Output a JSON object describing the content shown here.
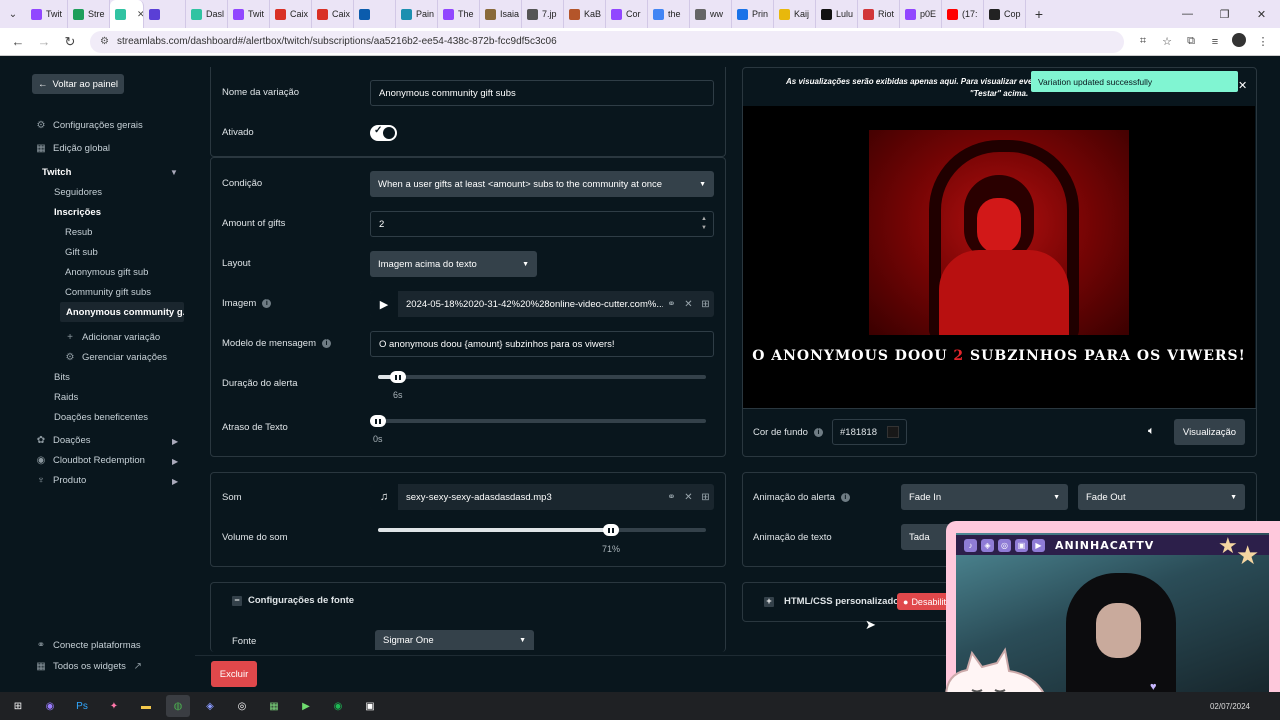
{
  "browser": {
    "tabs": [
      {
        "label": "Twit",
        "color": "#9146ff"
      },
      {
        "label": "Stre",
        "color": "#1e9e5b"
      },
      {
        "label": "",
        "color": "#31c3a2",
        "active": true
      },
      {
        "label": "",
        "color": "#5a3fd6"
      },
      {
        "label": "Dasl",
        "color": "#31c3a2"
      },
      {
        "label": "Twit",
        "color": "#9146ff"
      },
      {
        "label": "Caix",
        "color": "#d93025"
      },
      {
        "label": "Caix",
        "color": "#d93025"
      },
      {
        "label": "",
        "color": "#0b5cad"
      },
      {
        "label": "Pain",
        "color": "#1c8fb0"
      },
      {
        "label": "The",
        "color": "#9146ff"
      },
      {
        "label": "Isaia",
        "color": "#8a6a3a"
      },
      {
        "label": "7.jp",
        "color": "#555555"
      },
      {
        "label": "KaB",
        "color": "#b4552a"
      },
      {
        "label": "Cor",
        "color": "#9146ff"
      },
      {
        "label": "the",
        "color": "#4285f4"
      },
      {
        "label": "ww",
        "color": "#666666"
      },
      {
        "label": "Prin",
        "color": "#1a73e8"
      },
      {
        "label": "Kaij",
        "color": "#e8b80c"
      },
      {
        "label": "Lulu",
        "color": "#111111"
      },
      {
        "label": "Riot",
        "color": "#d13639"
      },
      {
        "label": "p0E",
        "color": "#9146ff"
      },
      {
        "label": "(17:",
        "color": "#ff0000"
      },
      {
        "label": "Cop",
        "color": "#222222"
      }
    ],
    "new_tab": "+",
    "url": "streamlabs.com/dashboard#/alertbox/twitch/subscriptions/aa5216b2-ee54-438c-872b-fcc9df5c3c06"
  },
  "sidebar": {
    "back_label": "Voltar ao painel",
    "items": [
      {
        "label": "Configurações gerais",
        "icon": "gear-icon"
      },
      {
        "label": "Edição global",
        "icon": "grid-icon"
      },
      {
        "label": "Twitch"
      },
      {
        "label": "Seguidores"
      },
      {
        "label": "Inscrições"
      },
      {
        "label": "Resub"
      },
      {
        "label": "Gift sub"
      },
      {
        "label": "Anonymous gift sub"
      },
      {
        "label": "Community gift subs"
      },
      {
        "label": "Anonymous community g..."
      },
      {
        "label": "Adicionar variação",
        "icon": "plus-icon"
      },
      {
        "label": "Gerenciar variações",
        "icon": "gear-icon"
      },
      {
        "label": "Bits"
      },
      {
        "label": "Raids"
      },
      {
        "label": "Doações beneficentes"
      },
      {
        "label": "Doações",
        "icon": "donation-icon"
      },
      {
        "label": "Cloudbot Redemption",
        "icon": "robot-icon"
      },
      {
        "label": "Produto",
        "icon": "shirt-icon"
      }
    ],
    "footer": {
      "connect": "Conecte plataformas",
      "widgets": "Todos os widgets"
    }
  },
  "form": {
    "variation_name_label": "Nome da variação",
    "variation_name": "Anonymous community gift subs",
    "enabled_label": "Ativado",
    "condition_label": "Condição",
    "condition_value": "When a user gifts at least <amount> subs to the community at once",
    "amount_label": "Amount of gifts",
    "amount_value": "2",
    "layout_label": "Layout",
    "layout_value": "Imagem acima do texto",
    "image_label": "Imagem",
    "image_file": "2024-05-18%2020-31-42%20%28online-video-cutter.com%...",
    "message_label": "Modelo de mensagem",
    "message_value": "O anonymous doou {amount} subzinhos  para os viwers!",
    "duration_label": "Duração do alerta",
    "duration_value": "6s",
    "duration_fraction": 0.06,
    "text_delay_label": "Atraso de Texto",
    "text_delay_value": "0s",
    "text_delay_fraction": 0.0,
    "sound_label": "Som",
    "sound_file": "sexy-sexy-sexy-adasdasdasd.mp3",
    "volume_label": "Volume do som",
    "volume_value": "71%",
    "volume_fraction": 0.71,
    "font_section": "Configurações de fonte",
    "font_label": "Fonte",
    "font_value": "Sigmar One",
    "delete_label": "Excluir"
  },
  "preview": {
    "notice": "As visualizações serão exibidas apenas aqui. Para visualizar eventos no software de streaming, clique no botão \"Testar\" acima.",
    "toast": "Variation updated successfully",
    "message_before": "O anonymous doou ",
    "message_amount": "2",
    "message_after": " subzinhos para os viwers!",
    "bg_color_label": "Cor de fundo",
    "bg_color_value": "#181818",
    "preview_button": "Visualização",
    "alert_anim_label": "Animação do alerta",
    "anim_in": "Fade In",
    "anim_out": "Fade Out",
    "text_anim_label": "Animação de texto",
    "text_anim_value": "Tada",
    "custom_html_label": "HTML/CSS personalizado",
    "custom_html_status": "Desabilit"
  },
  "webcam": {
    "handle": "ANINHACATTV"
  },
  "taskbar": {
    "clock": "02/07/2024"
  }
}
